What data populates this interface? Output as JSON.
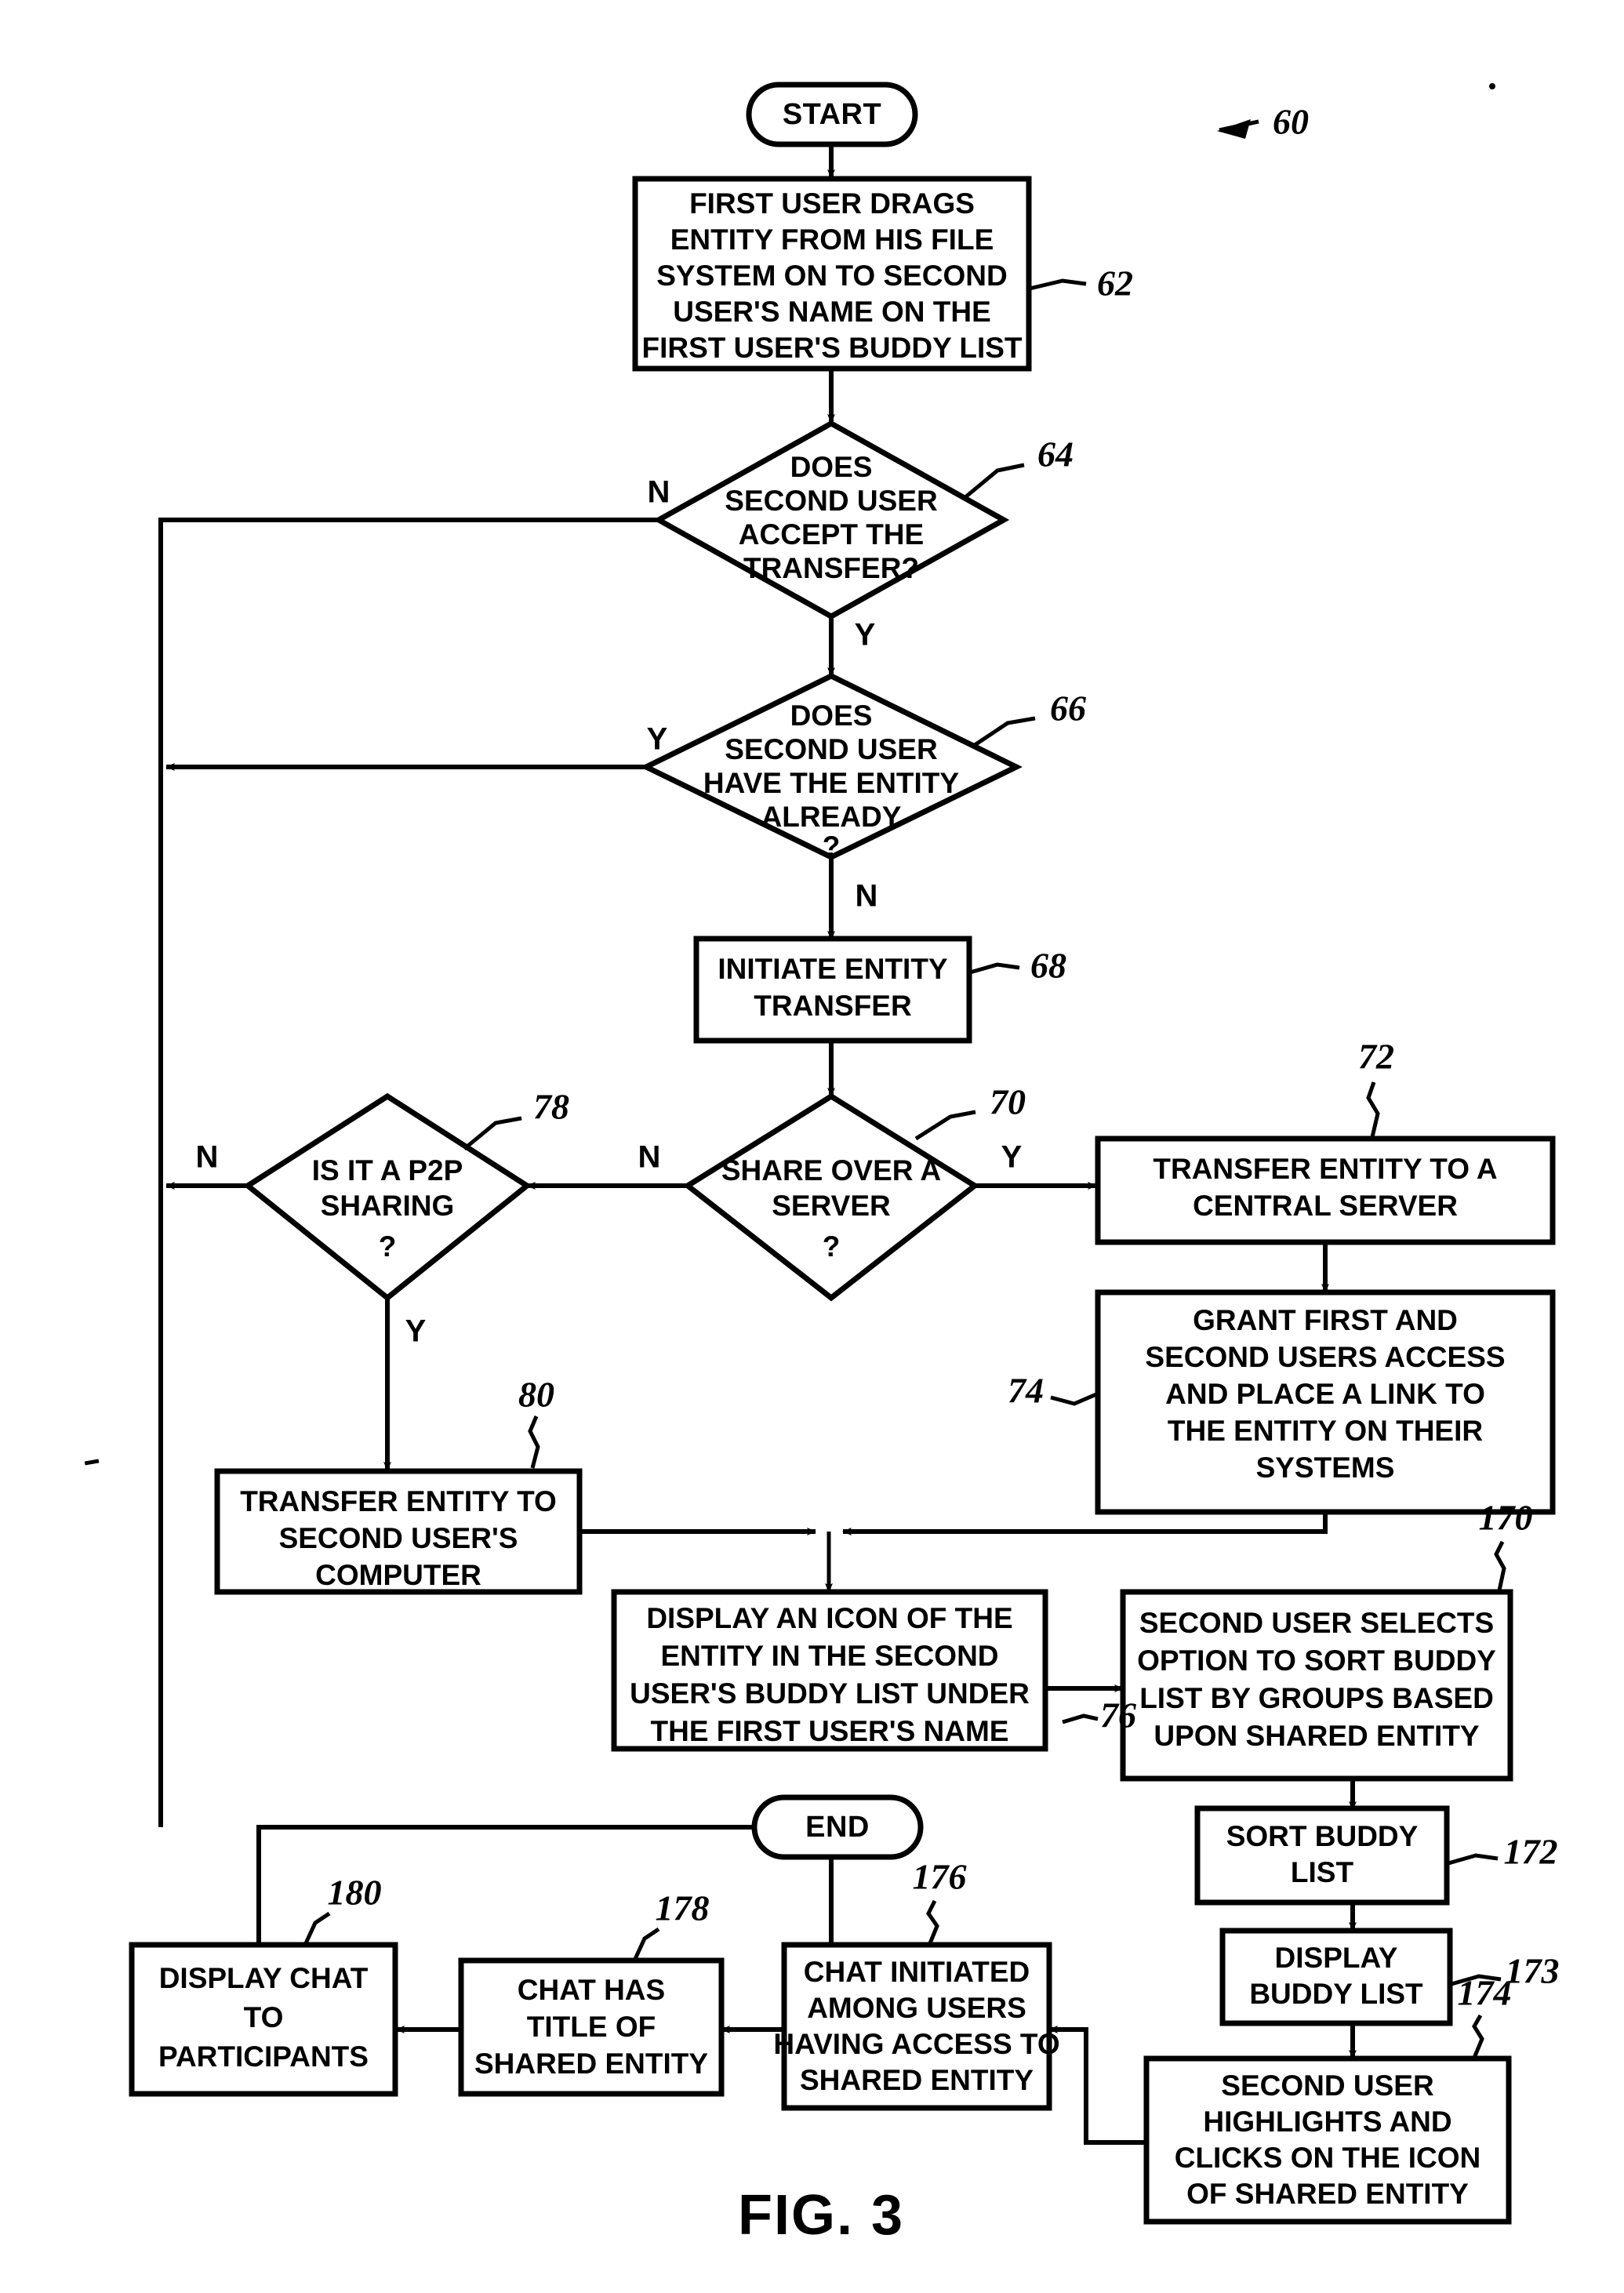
{
  "figure": {
    "caption": "FIG. 3",
    "diagram_ref": "60"
  },
  "nodes": {
    "start": {
      "label": "START",
      "shape": "terminator"
    },
    "end": {
      "label": "END",
      "shape": "terminator"
    },
    "n62": {
      "ref": "62",
      "shape": "process",
      "lines": [
        "FIRST USER DRAGS",
        "ENTITY FROM HIS FILE",
        "SYSTEM ON TO SECOND",
        "USER'S  NAME ON THE",
        "FIRST USER'S BUDDY LIST"
      ]
    },
    "n64": {
      "ref": "64",
      "shape": "decision",
      "lines": [
        "DOES",
        "SECOND USER",
        "ACCEPT THE",
        "TRANSFER?"
      ]
    },
    "n66": {
      "ref": "66",
      "shape": "decision",
      "lines": [
        "DOES",
        "SECOND USER",
        "HAVE THE ENTITY",
        "ALREADY",
        "?"
      ]
    },
    "n68": {
      "ref": "68",
      "shape": "process",
      "lines": [
        "INITIATE ENTITY",
        "TRANSFER"
      ]
    },
    "n70": {
      "ref": "70",
      "shape": "decision",
      "lines": [
        "SHARE OVER A",
        "SERVER",
        "?"
      ]
    },
    "n72": {
      "ref": "72",
      "shape": "process",
      "lines": [
        "TRANSFER ENTITY TO A",
        "CENTRAL SERVER"
      ]
    },
    "n74": {
      "ref": "74",
      "shape": "process",
      "lines": [
        "GRANT FIRST AND",
        "SECOND USERS ACCESS",
        "AND PLACE A LINK TO",
        "THE ENTITY ON THEIR",
        "SYSTEMS"
      ]
    },
    "n78": {
      "ref": "78",
      "shape": "decision",
      "lines": [
        "IS IT A P2P",
        "SHARING",
        "?"
      ]
    },
    "n80": {
      "ref": "80",
      "shape": "process",
      "lines": [
        "TRANSFER ENTITY TO",
        "SECOND USER'S",
        "COMPUTER"
      ]
    },
    "n76": {
      "ref": "76",
      "shape": "process",
      "lines": [
        "DISPLAY AN ICON OF THE",
        "ENTITY IN THE SECOND",
        "USER'S BUDDY LIST UNDER",
        "THE FIRST USER'S NAME"
      ]
    },
    "n170": {
      "ref": "170",
      "shape": "process",
      "lines": [
        "SECOND USER SELECTS",
        "OPTION TO SORT BUDDY",
        "LIST BY GROUPS BASED",
        "UPON SHARED ENTITY"
      ]
    },
    "n172": {
      "ref": "172",
      "shape": "process",
      "lines": [
        "SORT BUDDY",
        "LIST"
      ]
    },
    "n173": {
      "ref": "173",
      "shape": "process",
      "lines": [
        "DISPLAY",
        "BUDDY LIST"
      ]
    },
    "n174": {
      "ref": "174",
      "shape": "process",
      "lines": [
        "SECOND USER",
        "HIGHLIGHTS AND",
        "CLICKS ON THE ICON",
        "OF SHARED ENTITY"
      ]
    },
    "n176": {
      "ref": "176",
      "shape": "process",
      "lines": [
        "CHAT INITIATED",
        "AMONG USERS",
        "HAVING ACCESS TO",
        "SHARED ENTITY"
      ]
    },
    "n178": {
      "ref": "178",
      "shape": "process",
      "lines": [
        "CHAT HAS",
        "TITLE OF",
        "SHARED ENTITY"
      ]
    },
    "n180": {
      "ref": "180",
      "shape": "process",
      "lines": [
        "DISPLAY CHAT",
        "TO",
        "PARTICIPANTS"
      ]
    }
  },
  "branch_labels": {
    "n64_no": "N",
    "n64_yes": "Y",
    "n66_yes": "Y",
    "n66_no": "N",
    "n70_no": "N",
    "n70_yes": "Y",
    "n78_no": "N",
    "n78_yes": "Y"
  },
  "chart_data": {
    "type": "flowchart",
    "title": "FIG. 3",
    "nodes": [
      {
        "id": "start",
        "type": "terminator",
        "text": "START"
      },
      {
        "id": "62",
        "type": "process",
        "text": "FIRST USER DRAGS ENTITY FROM HIS FILE SYSTEM ON TO SECOND USER'S  NAME ON THE FIRST USER'S BUDDY LIST"
      },
      {
        "id": "64",
        "type": "decision",
        "text": "DOES SECOND USER ACCEPT THE TRANSFER?"
      },
      {
        "id": "66",
        "type": "decision",
        "text": "DOES SECOND USER HAVE THE ENTITY ALREADY ?"
      },
      {
        "id": "68",
        "type": "process",
        "text": "INITIATE ENTITY TRANSFER"
      },
      {
        "id": "70",
        "type": "decision",
        "text": "SHARE OVER A SERVER ?"
      },
      {
        "id": "72",
        "type": "process",
        "text": "TRANSFER ENTITY TO A CENTRAL SERVER"
      },
      {
        "id": "74",
        "type": "process",
        "text": "GRANT FIRST AND SECOND USERS ACCESS AND PLACE A LINK TO THE ENTITY ON THEIR SYSTEMS"
      },
      {
        "id": "78",
        "type": "decision",
        "text": "IS IT A P2P SHARING ?"
      },
      {
        "id": "80",
        "type": "process",
        "text": "TRANSFER ENTITY TO SECOND USER'S COMPUTER"
      },
      {
        "id": "76",
        "type": "process",
        "text": "DISPLAY AN ICON OF THE ENTITY IN THE SECOND USER'S BUDDY LIST UNDER THE FIRST USER'S NAME"
      },
      {
        "id": "170",
        "type": "process",
        "text": "SECOND USER SELECTS OPTION TO SORT BUDDY LIST BY GROUPS BASED UPON SHARED ENTITY"
      },
      {
        "id": "172",
        "type": "process",
        "text": "SORT BUDDY LIST"
      },
      {
        "id": "173",
        "type": "process",
        "text": "DISPLAY BUDDY LIST"
      },
      {
        "id": "174",
        "type": "process",
        "text": "SECOND USER HIGHLIGHTS AND CLICKS ON THE ICON OF SHARED ENTITY"
      },
      {
        "id": "176",
        "type": "process",
        "text": "CHAT INITIATED AMONG USERS HAVING ACCESS TO SHARED ENTITY"
      },
      {
        "id": "178",
        "type": "process",
        "text": "CHAT HAS TITLE OF SHARED ENTITY"
      },
      {
        "id": "180",
        "type": "process",
        "text": "DISPLAY CHAT TO PARTICIPANTS"
      },
      {
        "id": "end",
        "type": "terminator",
        "text": "END"
      }
    ],
    "edges": [
      {
        "from": "start",
        "to": "62",
        "label": ""
      },
      {
        "from": "62",
        "to": "64",
        "label": ""
      },
      {
        "from": "64",
        "to": "end",
        "label": "N"
      },
      {
        "from": "64",
        "to": "66",
        "label": "Y"
      },
      {
        "from": "66",
        "to": "end",
        "label": "Y"
      },
      {
        "from": "66",
        "to": "68",
        "label": "N"
      },
      {
        "from": "68",
        "to": "70",
        "label": ""
      },
      {
        "from": "70",
        "to": "72",
        "label": "Y"
      },
      {
        "from": "70",
        "to": "78",
        "label": "N"
      },
      {
        "from": "72",
        "to": "74",
        "label": ""
      },
      {
        "from": "74",
        "to": "76",
        "label": ""
      },
      {
        "from": "78",
        "to": "end",
        "label": "N"
      },
      {
        "from": "78",
        "to": "80",
        "label": "Y"
      },
      {
        "from": "80",
        "to": "76",
        "label": ""
      },
      {
        "from": "76",
        "to": "170",
        "label": ""
      },
      {
        "from": "170",
        "to": "172",
        "label": ""
      },
      {
        "from": "172",
        "to": "173",
        "label": ""
      },
      {
        "from": "173",
        "to": "174",
        "label": ""
      },
      {
        "from": "174",
        "to": "176",
        "label": ""
      },
      {
        "from": "176",
        "to": "178",
        "label": ""
      },
      {
        "from": "176",
        "to": "end",
        "label": ""
      },
      {
        "from": "178",
        "to": "180",
        "label": ""
      },
      {
        "from": "180",
        "to": "end",
        "label": ""
      }
    ]
  }
}
